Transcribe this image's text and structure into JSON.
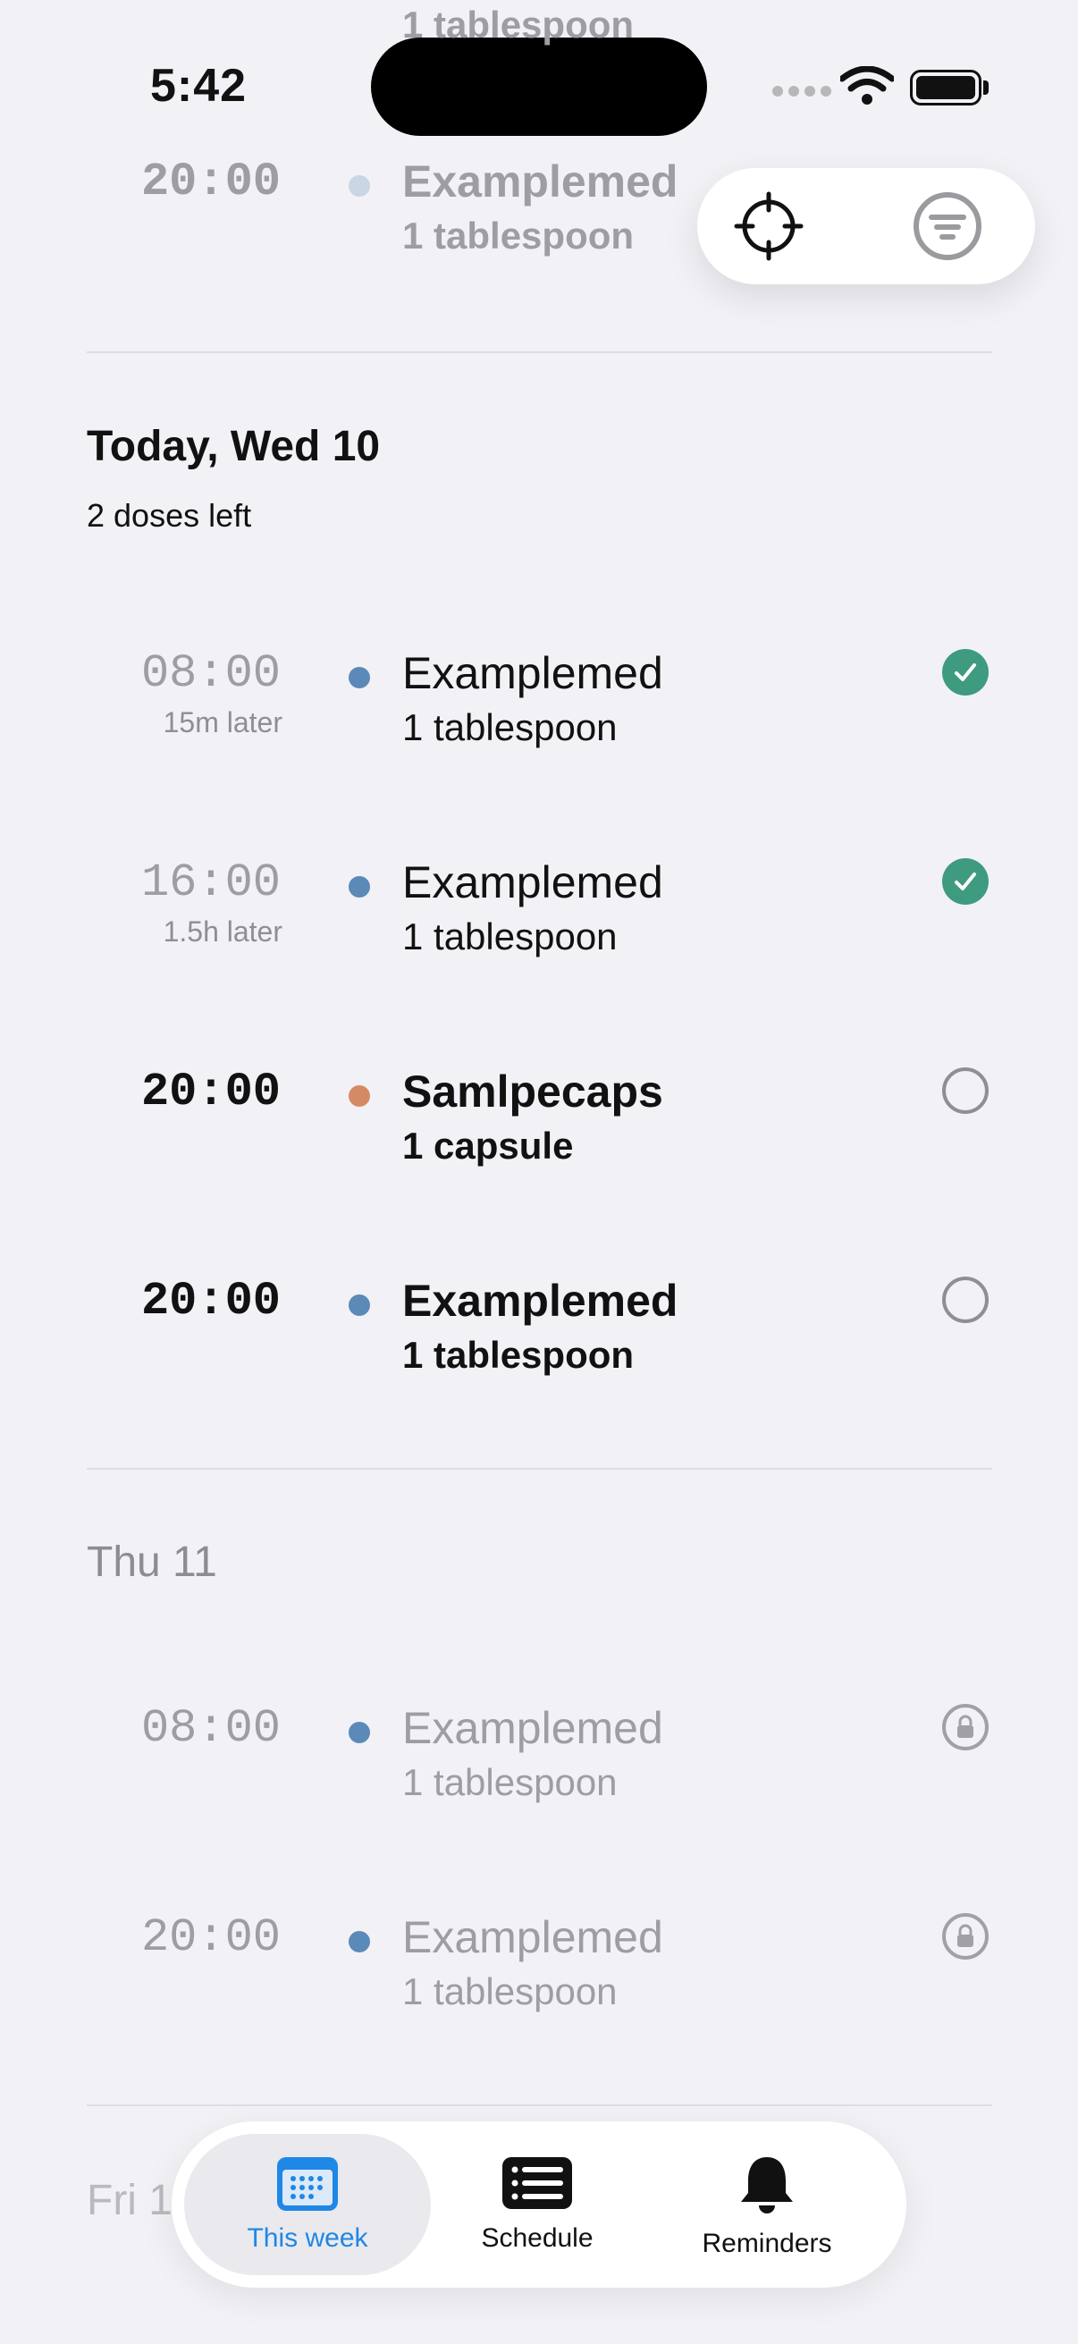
{
  "status": {
    "time": "5:42"
  },
  "prev_day": {
    "partial_dose_top": "1 tablespoon",
    "row": {
      "time": "20:00",
      "name": "Examplemed",
      "dose": "1 tablespoon",
      "dot_color": "#c9d6e3"
    }
  },
  "today": {
    "title": "Today, Wed 10",
    "subtitle": "2 doses left",
    "rows": [
      {
        "time": "08:00",
        "time_note": "15m later",
        "name": "Examplemed",
        "dose": "1 tablespoon",
        "dot_color": "#5b8ab8",
        "state": "taken"
      },
      {
        "time": "16:00",
        "time_note": "1.5h later",
        "name": "Examplemed",
        "dose": "1 tablespoon",
        "dot_color": "#5b8ab8",
        "state": "taken"
      },
      {
        "time": "20:00",
        "time_note": "",
        "name": "Samlpecaps",
        "dose": "1 capsule",
        "dot_color": "#d58a64",
        "state": "pending"
      },
      {
        "time": "20:00",
        "time_note": "",
        "name": "Examplemed",
        "dose": "1 tablespoon",
        "dot_color": "#5b8ab8",
        "state": "pending"
      }
    ]
  },
  "thursday": {
    "title": "Thu 11",
    "rows": [
      {
        "time": "08:00",
        "name": "Examplemed",
        "dose": "1 tablespoon",
        "dot_color": "#5b8ab8",
        "state": "locked"
      },
      {
        "time": "20:00",
        "name": "Examplemed",
        "dose": "1 tablespoon",
        "dot_color": "#5b8ab8",
        "state": "locked"
      }
    ]
  },
  "friday": {
    "title": "Fri 12"
  },
  "tabs": [
    {
      "label": "This week",
      "icon": "calendar-icon",
      "active": true
    },
    {
      "label": "Schedule",
      "icon": "list-icon",
      "active": false
    },
    {
      "label": "Reminders",
      "icon": "bell-icon",
      "active": false
    }
  ],
  "colors": {
    "accent": "#1f87e5",
    "taken": "#3e9b7f",
    "background": "#f2f1f6"
  }
}
